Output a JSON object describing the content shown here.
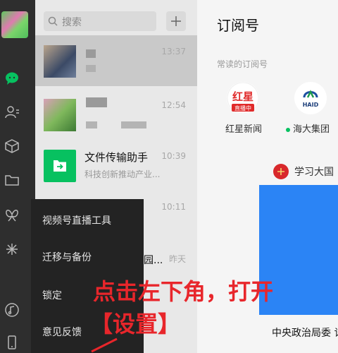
{
  "search": {
    "placeholder": "搜索"
  },
  "chat_list": [
    {
      "time": "13:37"
    },
    {
      "time": "12:54"
    },
    {
      "title": "文件传输助手",
      "subtitle": "科技创新推动产业...",
      "time": "10:39"
    },
    {
      "time": "10:11"
    },
    {
      "title_fragment": "园...",
      "time": "昨天"
    }
  ],
  "main": {
    "title": "订阅号",
    "section_label": "常读的订阅号",
    "accounts": [
      {
        "name": "红星新闻",
        "logo_text": "红星",
        "logo_badge": "直播中"
      },
      {
        "name": "海大集团",
        "logo_text": "HAID",
        "unread": true
      }
    ],
    "feed": {
      "account": "学习大国",
      "caption": "中央政治局委 记述职"
    }
  },
  "menu": {
    "items": [
      "视频号直播工具",
      "迁移与备份",
      "锁定",
      "意见反馈"
    ]
  },
  "annotation": {
    "line1": "点击左下角，打开",
    "line2": "【设置】"
  },
  "colors": {
    "brand_green": "#07c160",
    "annotation_red": "#e8262b",
    "feed_image_blue": "#2b84f5"
  }
}
